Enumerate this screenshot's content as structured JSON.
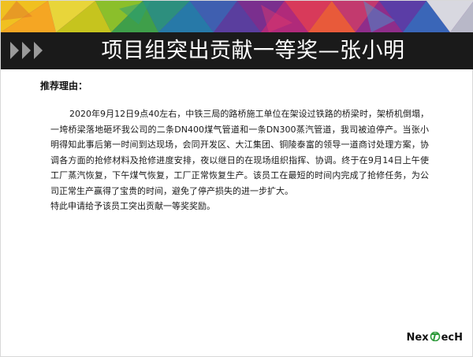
{
  "slide": {
    "title": "项目组突出贡献一等奖—张小明",
    "reason_label": "推荐理由：",
    "paragraph1": "2020年9月12日9点40左右，中铁三局的路桥施工单位在架设过铁路的桥梁时，架桥机倒塌，一垮桥梁落地砸坏我公司的二条DN400煤气管道和一条DN300蒸汽管道，我司被迫停产。当张小明得知此事后第一时间到达现场，会同开发区、大江集团、铜陵泰富的领导一道商讨处理方案，协调各方面的抢修材料及抢修进度安排，夜以继日的在现场组织指挥、协调。终于在9月14日上午使工厂蒸汽恢复，下午煤气恢复，工厂正常恢复生产。该员工在最短的时间内完成了抢修任务，为公司正常生产赢得了宝贵的时间，避免了停产损失的进一步扩大。",
    "paragraph2": "特此申请给予该员工突出贡献一等奖奖励。"
  },
  "logo": {
    "prefix": "Nex",
    "suffix": "ecH"
  },
  "colors": {
    "title_bar": "#1a1a1a",
    "title_text": "#ffffff",
    "arrow": "#9a9a9a"
  }
}
